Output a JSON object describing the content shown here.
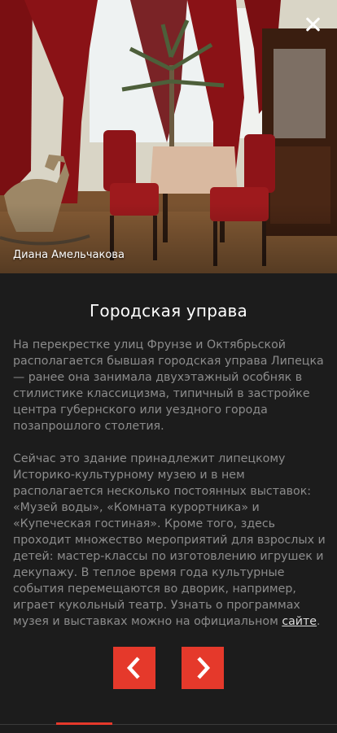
{
  "photo": {
    "credit": "Диана Амельчакова"
  },
  "close_icon": "close-icon",
  "article": {
    "title": "Городская управа",
    "paragraph1": "На перекрестке улиц Фрунзе и Октябрьской располагается бывшая городская управа Липецка — ранее она занимала двухэтажный особняк в стилистике классицизма, типичный в застройке центра губернского или уездного города позапрошлого столетия.",
    "paragraph2": "Сейчас это здание принадлежит липецкому Историко-культурному музею и в нем располагается несколько постоянных выставок: «Музей воды», «Комната курортника» и «Купеческая гостиная». Кроме того, здесь проходит множество мероприятий для взрослых и детей: мастер-классы по изготовлению игрушек и декупажу. В теплое время года культурные события перемещаются во дворик, например, играет кукольный театр. Узнать о программах музея и выставках можно на официальном ",
    "link_text": "сайте",
    "paragraph2_end": "."
  },
  "nav": {
    "prev_icon": "chevron-left-icon",
    "next_icon": "chevron-right-icon"
  },
  "colors": {
    "accent": "#e5392b",
    "background": "#1c1c1c"
  }
}
